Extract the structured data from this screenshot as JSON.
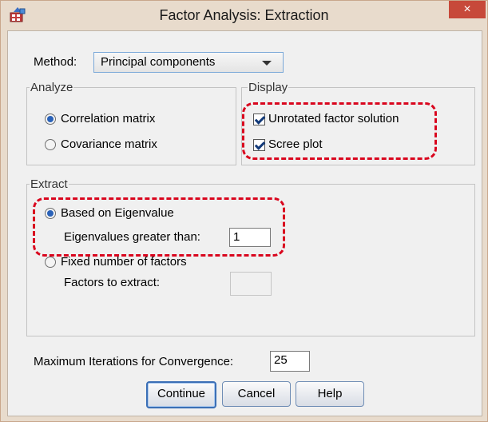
{
  "window": {
    "title": "Factor Analysis: Extraction",
    "close_glyph": "×"
  },
  "method": {
    "label": "Method:",
    "value": "Principal components"
  },
  "analyze": {
    "title": "Analyze",
    "options": [
      {
        "label": "Correlation matrix",
        "selected": true
      },
      {
        "label": "Covariance matrix",
        "selected": false
      }
    ]
  },
  "display": {
    "title": "Display",
    "options": [
      {
        "label": "Unrotated factor solution",
        "checked": true
      },
      {
        "label": "Scree plot",
        "checked": true
      }
    ]
  },
  "extract": {
    "title": "Extract",
    "eigen_option": "Based on Eigenvalue",
    "eigen_label": "Eigenvalues greater than:",
    "eigen_value": "1",
    "fixed_option": "Fixed number of factors",
    "factors_label": "Factors to extract:",
    "factors_value": ""
  },
  "iterations": {
    "label": "Maximum Iterations for Convergence:",
    "value": "25"
  },
  "buttons": {
    "continue": "Continue",
    "cancel": "Cancel",
    "help": "Help"
  },
  "colors": {
    "highlight": "#d9061e",
    "radio_selected": "#2a62b8",
    "close_button": "#c7493a"
  }
}
